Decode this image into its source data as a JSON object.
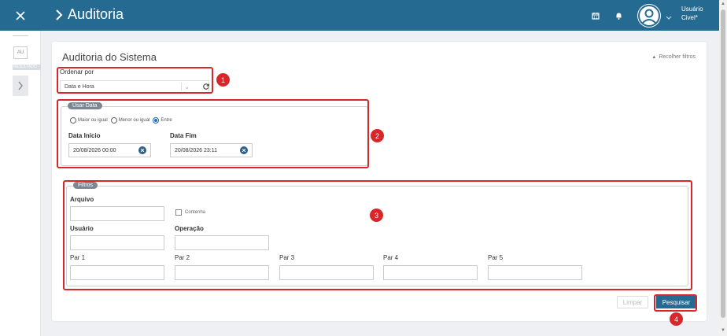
{
  "topbar": {
    "title": "Auditoria",
    "user_name": "Usuário",
    "user_role": "Civel*",
    "icons": [
      "close-icon",
      "chevron-right-icon",
      "calendar-icon",
      "bell-icon",
      "user-avatar-icon",
      "chevron-down-icon"
    ],
    "color": "#256b91"
  },
  "sidebar": {
    "box_label": "AU",
    "tag_label": "RESULTADO"
  },
  "main": {
    "title": "Auditoria do Sistema",
    "collapse_filters": "Recolher filtros",
    "order_label": "Ordenar por",
    "order_value": "Data e Hora",
    "date_group": {
      "legend": "Usar Data",
      "options": [
        "Maior ou igual",
        "Menor ou igual",
        "Entre"
      ],
      "selected": "Entre",
      "start_label": "Data Início",
      "start_value": "20/08/2026 00:00",
      "end_label": "Data Fim",
      "end_value": "20/08/2026 23:11"
    },
    "filters_group": {
      "legend": "Filtros",
      "arquivo_label": "Arquivo",
      "contenha_label": "Contenha",
      "usuario_label": "Usuário",
      "operacao_label": "Operação",
      "par1_label": "Par 1",
      "par2_label": "Par 2",
      "par3_label": "Par 3",
      "par4_label": "Par 4",
      "par5_label": "Par 5"
    },
    "buttons": {
      "clear": "Limpar",
      "search": "Pesquisar"
    }
  },
  "annotations": [
    "1",
    "2",
    "3",
    "4"
  ],
  "colors": {
    "accent": "#256b91",
    "annotation": "#d8262b"
  }
}
